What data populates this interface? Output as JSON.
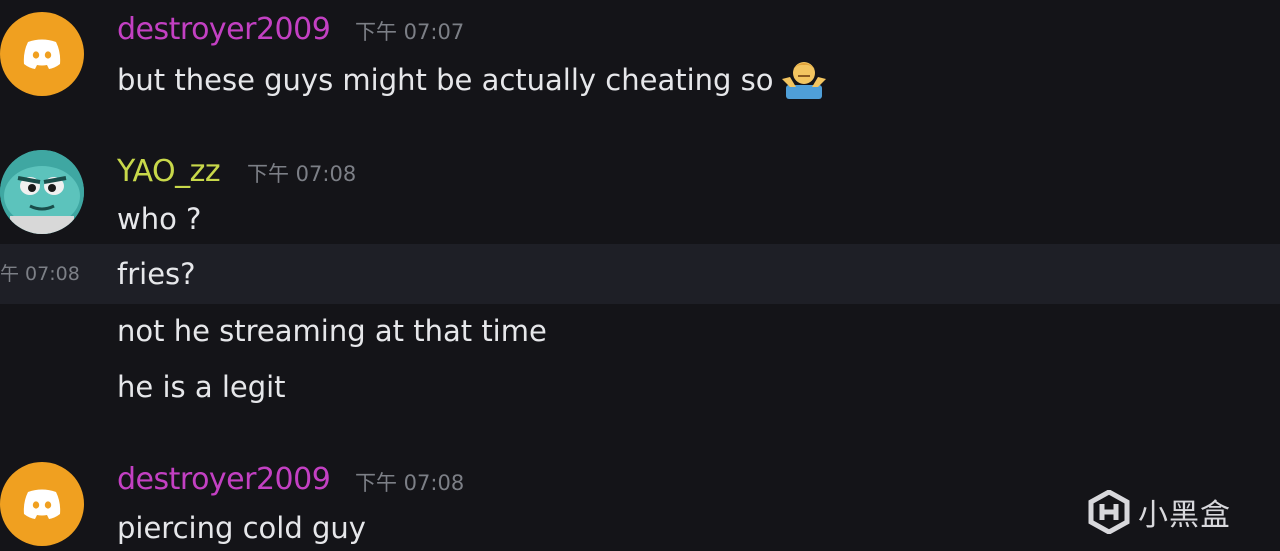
{
  "messages": [
    {
      "username": "destroyer2009",
      "username_color": "#c340c3",
      "avatar": "discord-logo-avatar",
      "timestamp": "下午 07:07",
      "lines": [
        "but these guys might be actually cheating so"
      ],
      "emoji": "person-shrugging-emoji"
    },
    {
      "username": "YAO_zz",
      "username_color": "#c8d84a",
      "avatar": "cartoon-character-avatar",
      "timestamp": "下午 07:08",
      "lines": [
        "who ?",
        "fries?",
        "not he streaming at that time",
        "he is a legit"
      ]
    },
    {
      "username": "destroyer2009",
      "username_color": "#c340c3",
      "avatar": "discord-logo-avatar",
      "timestamp": "下午 07:08",
      "lines": [
        "piercing cold guy"
      ]
    }
  ],
  "hover": {
    "timestamp": "午 07:08"
  },
  "watermark": {
    "text": "小黑盒",
    "icon": "heybox-logo-icon"
  },
  "colors": {
    "background": "#141418",
    "hover_row": "#1e1f26",
    "message_text": "#e6e7ea",
    "timestamp": "#7c7f86"
  }
}
